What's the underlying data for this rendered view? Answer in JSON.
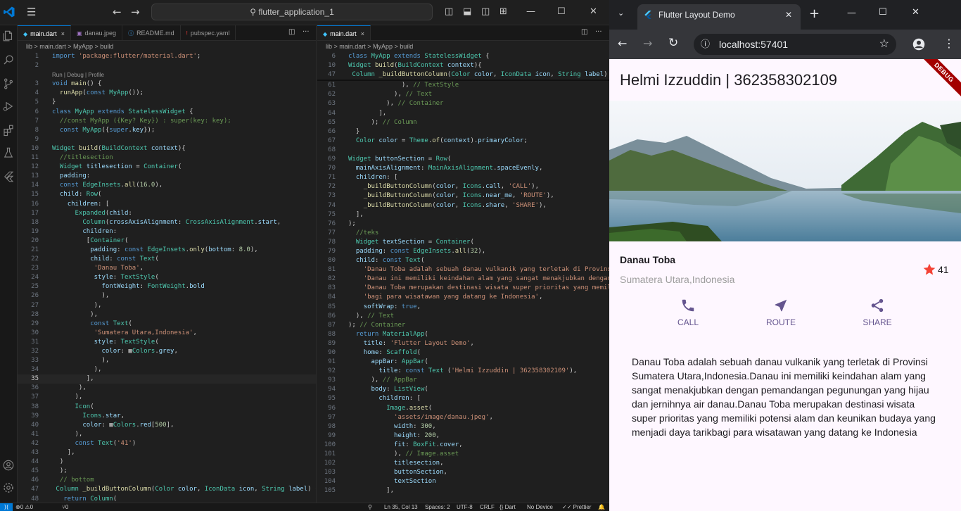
{
  "vscode": {
    "search_text": "flutter_application_1",
    "left_tabs": [
      {
        "label": "main.dart",
        "active": true,
        "icon": "dart-icon"
      },
      {
        "label": "danau.jpeg",
        "active": false,
        "icon": "image-icon"
      },
      {
        "label": "README.md",
        "active": false,
        "icon": "info-icon"
      },
      {
        "label": "pubspec.yaml",
        "active": false,
        "icon": "yaml-icon"
      }
    ],
    "right_tabs": [
      {
        "label": "main.dart",
        "active": true,
        "icon": "dart-icon"
      }
    ],
    "breadcrumb_left": "lib  >  main.dart  >  MyApp  >  build",
    "breadcrumb_right": "lib  >  main.dart  >  MyApp  >  build",
    "codelens": "Run | Debug | Profile",
    "left_code": [
      {
        "n": "1",
        "t": "import 'package:flutter/material.dart';"
      },
      {
        "n": "2",
        "t": ""
      },
      {
        "n": "",
        "t": "Run | Debug | Profile",
        "lens": true
      },
      {
        "n": "3",
        "t": "void main() {"
      },
      {
        "n": "4",
        "t": "  runApp(const MyApp());"
      },
      {
        "n": "5",
        "t": "}"
      },
      {
        "n": "6",
        "t": "class MyApp extends StatelessWidget {"
      },
      {
        "n": "7",
        "t": "  //const MyApp ({Key? Key}) : super(key: key);"
      },
      {
        "n": "8",
        "t": "  const MyApp({super.key});"
      },
      {
        "n": "9",
        "t": ""
      },
      {
        "n": "10",
        "t": "Widget build(BuildContext context){"
      },
      {
        "n": "11",
        "t": "  //titlesection"
      },
      {
        "n": "12",
        "t": "  Widget titlesection = Container("
      },
      {
        "n": "13",
        "t": "  padding:"
      },
      {
        "n": "14",
        "t": "  const EdgeInsets.all(16.0),"
      },
      {
        "n": "15",
        "t": "  child: Row("
      },
      {
        "n": "16",
        "t": "    children: ["
      },
      {
        "n": "17",
        "t": "      Expanded(child:"
      },
      {
        "n": "18",
        "t": "        Column(crossAxisAlignment: CrossAxisAlignment.start,"
      },
      {
        "n": "19",
        "t": "        children:"
      },
      {
        "n": "20",
        "t": "         [Container("
      },
      {
        "n": "21",
        "t": "          padding: const EdgeInsets.only(bottom: 8.0),"
      },
      {
        "n": "22",
        "t": "          child: const Text("
      },
      {
        "n": "23",
        "t": "           'Danau Toba',"
      },
      {
        "n": "24",
        "t": "           style: TextStyle("
      },
      {
        "n": "25",
        "t": "             fontWeight: FontWeight.bold"
      },
      {
        "n": "26",
        "t": "             ),"
      },
      {
        "n": "27",
        "t": "           ),"
      },
      {
        "n": "28",
        "t": "          ),"
      },
      {
        "n": "29",
        "t": "          const Text("
      },
      {
        "n": "30",
        "t": "           'Sumatera Utara,Indonesia',"
      },
      {
        "n": "31",
        "t": "           style: TextStyle("
      },
      {
        "n": "32",
        "t": "             color: ■Colors.grey,"
      },
      {
        "n": "33",
        "t": "             ),"
      },
      {
        "n": "34",
        "t": "           ),"
      },
      {
        "n": "35",
        "t": "         ],",
        "current": true
      },
      {
        "n": "36",
        "t": "       ),"
      },
      {
        "n": "37",
        "t": "      ),"
      },
      {
        "n": "38",
        "t": "      Icon("
      },
      {
        "n": "39",
        "t": "        Icons.star,"
      },
      {
        "n": "40",
        "t": "        color: ■Colors.red[500],"
      },
      {
        "n": "41",
        "t": "      ),"
      },
      {
        "n": "42",
        "t": "      const Text('41')"
      },
      {
        "n": "43",
        "t": "    ],"
      },
      {
        "n": "44",
        "t": "  )"
      },
      {
        "n": "45",
        "t": "  );"
      },
      {
        "n": "46",
        "t": "  // bottom"
      },
      {
        "n": "47",
        "t": " Column _buildButtonColumn(Color color, IconData icon, String label) {"
      },
      {
        "n": "48",
        "t": "   return Column("
      }
    ],
    "right_sticky": [
      {
        "n": "6",
        "t": "class MyApp extends StatelessWidget {"
      },
      {
        "n": "10",
        "t": "Widget build(BuildContext context){"
      },
      {
        "n": "47",
        "t": " Column _buildButtonColumn(Color color, IconData icon, String label)"
      }
    ],
    "right_code": [
      {
        "n": "61",
        "t": "              ), // TextStyle"
      },
      {
        "n": "62",
        "t": "            ), // Text"
      },
      {
        "n": "63",
        "t": "          ), // Container"
      },
      {
        "n": "64",
        "t": "        ],"
      },
      {
        "n": "65",
        "t": "      ); // Column"
      },
      {
        "n": "66",
        "t": "  }"
      },
      {
        "n": "67",
        "t": "  Color color = Theme.of(context).primaryColor;"
      },
      {
        "n": "68",
        "t": ""
      },
      {
        "n": "69",
        "t": "Widget buttonSection = Row("
      },
      {
        "n": "70",
        "t": "  mainAxisAlignment: MainAxisAlignment.spaceEvenly,"
      },
      {
        "n": "71",
        "t": "  children: ["
      },
      {
        "n": "72",
        "t": "    _buildButtonColumn(color, Icons.call, 'CALL'),"
      },
      {
        "n": "73",
        "t": "    _buildButtonColumn(color, Icons.near_me, 'ROUTE'),"
      },
      {
        "n": "74",
        "t": "    _buildButtonColumn(color, Icons.share, 'SHARE'),"
      },
      {
        "n": "75",
        "t": "  ],"
      },
      {
        "n": "76",
        "t": ");"
      },
      {
        "n": "77",
        "t": "  //teks"
      },
      {
        "n": "78",
        "t": "  Widget textSection = Container("
      },
      {
        "n": "79",
        "t": "  padding: const EdgeInsets.all(32),"
      },
      {
        "n": "80",
        "t": "  child: const Text("
      },
      {
        "n": "81",
        "t": "    'Danau Toba adalah sebuah danau vulkanik yang terletak di Provinsi"
      },
      {
        "n": "82",
        "t": "    'Danau ini memiliki keindahan alam yang sangat menakjubkan dengan"
      },
      {
        "n": "83",
        "t": "    'Danau Toba merupakan destinasi wisata super prioritas yang memili"
      },
      {
        "n": "84",
        "t": "    'bagi para wisatawan yang datang ke Indonesia',"
      },
      {
        "n": "85",
        "t": "    softWrap: true,"
      },
      {
        "n": "86",
        "t": "  ), // Text"
      },
      {
        "n": "87",
        "t": "); // Container"
      },
      {
        "n": "88",
        "t": "  return MaterialApp("
      },
      {
        "n": "89",
        "t": "    title: 'Flutter Layout Demo',"
      },
      {
        "n": "90",
        "t": "    home: Scaffold("
      },
      {
        "n": "91",
        "t": "      appBar: AppBar("
      },
      {
        "n": "92",
        "t": "        title: const Text ('Helmi Izzuddin | 362358302109'),"
      },
      {
        "n": "93",
        "t": "      ), // AppBar"
      },
      {
        "n": "94",
        "t": "      body: ListView("
      },
      {
        "n": "95",
        "t": "        children: ["
      },
      {
        "n": "96",
        "t": "          Image.asset("
      },
      {
        "n": "97",
        "t": "            'assets/image/danau.jpeg',"
      },
      {
        "n": "98",
        "t": "            width: 300,"
      },
      {
        "n": "99",
        "t": "            height: 200,"
      },
      {
        "n": "100",
        "t": "            fit: BoxFit.cover,"
      },
      {
        "n": "101",
        "t": "            ), // Image.asset"
      },
      {
        "n": "102",
        "t": "            titlesection,"
      },
      {
        "n": "103",
        "t": "            buttonSection,"
      },
      {
        "n": "104",
        "t": "            textSection"
      },
      {
        "n": "105",
        "t": "          ],"
      }
    ],
    "status": {
      "errors": "0",
      "warnings": "0",
      "ports": "0",
      "position": "Ln 35, Col 13",
      "spaces": "Spaces: 2",
      "encoding": "UTF-8",
      "eol": "CRLF",
      "language": "Dart",
      "device": "No Device",
      "formatter": "Prettier"
    }
  },
  "chrome": {
    "tab_title": "Flutter Layout Demo",
    "url": "localhost:57401"
  },
  "app": {
    "appbar_title": "Helmi Izzuddin | 362358302109",
    "debug_banner": "DEBUG",
    "place_title": "Danau Toba",
    "place_subtitle": "Sumatera Utara,Indonesia",
    "star_count": "41",
    "buttons": [
      {
        "label": "CALL",
        "icon": "call-icon"
      },
      {
        "label": "ROUTE",
        "icon": "near-me-icon"
      },
      {
        "label": "SHARE",
        "icon": "share-icon"
      }
    ],
    "description": "Danau Toba adalah sebuah danau vulkanik yang terletak di Provinsi Sumatera Utara,Indonesia.Danau ini memiliki keindahan alam yang sangat menakjubkan dengan pemandangan pegunungan yang hijau dan jernihnya air danau.Danau Toba merupakan destinasi wisata super prioritas yang memiliki potensi alam dan keunikan budaya yang menjadi daya tarikbagi para wisatawan yang datang ke Indonesia",
    "colors": {
      "primary": "#65558f",
      "star": "#f44336",
      "subtitle": "#9e9e9e",
      "background": "#fef7ff"
    }
  }
}
